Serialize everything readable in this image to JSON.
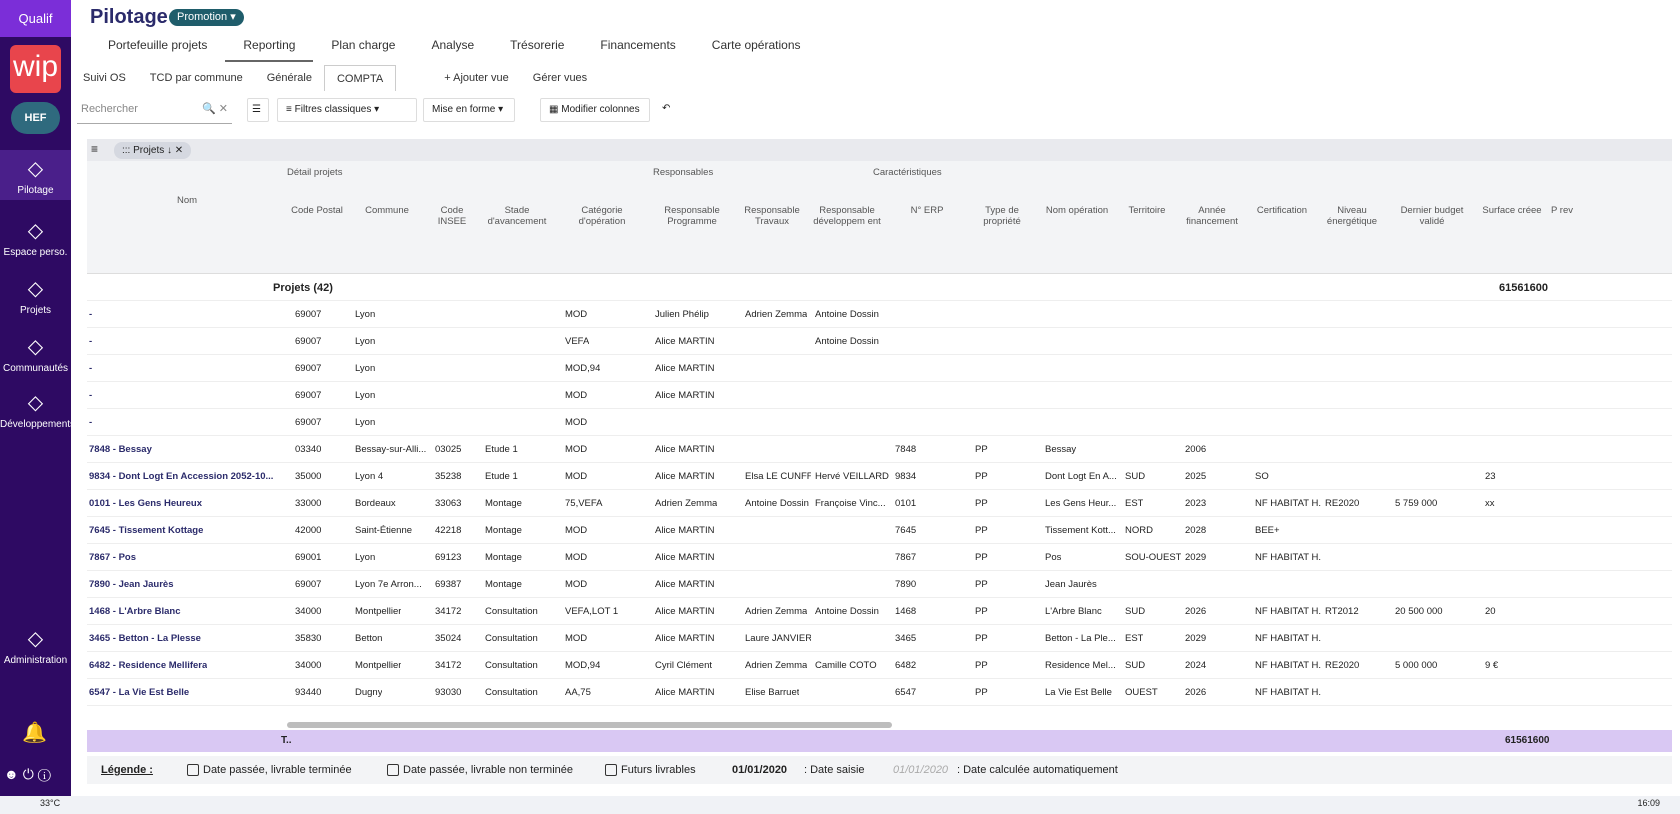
{
  "sidebar": {
    "env": "Qualif",
    "logo": "wip",
    "user": "HEF",
    "items": [
      {
        "label": "Pilotage",
        "icon": "chart-icon"
      },
      {
        "label": "Espace perso.",
        "icon": "home-icon"
      },
      {
        "label": "Projets",
        "icon": "map-icon"
      },
      {
        "label": "Communautés",
        "icon": "users-icon"
      },
      {
        "label": "Développements",
        "icon": "compass-icon"
      },
      {
        "label": "Administration",
        "icon": "gear-icon"
      }
    ]
  },
  "header": {
    "title": "Pilotage",
    "badge": "Promotion ▾"
  },
  "tabs1": [
    "Portefeuille projets",
    "Reporting",
    "Plan charge",
    "Analyse",
    "Trésorerie",
    "Financements",
    "Carte opérations"
  ],
  "tabs2": [
    "Suivi OS",
    "TCD par commune",
    "Générale",
    "COMPTA"
  ],
  "tabs2_actions": [
    "+ Ajouter vue",
    "Gérer vues"
  ],
  "toolbar": {
    "search_placeholder": "Rechercher",
    "filters": "Filtres classiques",
    "format": "Mise en forme",
    "columns": "Modifier colonnes"
  },
  "group_chip": "Projets",
  "header_groups": [
    "Détail projets",
    "Responsables",
    "Caractéristiques"
  ],
  "columns": [
    "Nom",
    "Code Postal",
    "Commune",
    "Code INSEE",
    "Stade d'avancement",
    "Catégorie d'opération",
    "Responsable Programme",
    "Responsable Travaux",
    "Responsable développem ent",
    "N° ERP",
    "Type de propriété",
    "Nom opération",
    "Territoire",
    "Année financement",
    "Certification",
    "Niveau énergétique",
    "Dernier budget validé",
    "Surface créee",
    "P rev"
  ],
  "group_row": {
    "label": "Projets (42)",
    "total": "61561600"
  },
  "rows": [
    [
      "-",
      "69007",
      "Lyon",
      "",
      "",
      "MOD",
      "Julien Phélip",
      "Adrien Zemma",
      "Antoine Dossin",
      "",
      "",
      "",
      "",
      "",
      "",
      "",
      "",
      ""
    ],
    [
      "-",
      "69007",
      "Lyon",
      "",
      "",
      "VEFA",
      "Alice MARTIN",
      "",
      "Antoine Dossin",
      "",
      "",
      "",
      "",
      "",
      "",
      "",
      "",
      ""
    ],
    [
      "-",
      "69007",
      "Lyon",
      "",
      "",
      "MOD,94",
      "Alice MARTIN",
      "",
      "",
      "",
      "",
      "",
      "",
      "",
      "",
      "",
      "",
      ""
    ],
    [
      "-",
      "69007",
      "Lyon",
      "",
      "",
      "MOD",
      "Alice MARTIN",
      "",
      "",
      "",
      "",
      "",
      "",
      "",
      "",
      "",
      "",
      ""
    ],
    [
      "-",
      "69007",
      "Lyon",
      "",
      "",
      "MOD",
      "",
      "",
      "",
      "",
      "",
      "",
      "",
      "",
      "",
      "",
      "",
      ""
    ],
    [
      "7848 - Bessay",
      "03340",
      "Bessay-sur-Alli...",
      "03025",
      "Etude 1",
      "MOD",
      "Alice MARTIN",
      "",
      "",
      "7848",
      "PP",
      "Bessay",
      "",
      "2006",
      "",
      "",
      "",
      ""
    ],
    [
      "9834 - Dont Logt En Accession 2052-10...",
      "35000",
      "Lyon 4",
      "35238",
      "Etude 1",
      "MOD",
      "Alice MARTIN",
      "Elsa LE CUNFF",
      "Hervé VEILLARD",
      "9834",
      "PP",
      "Dont Logt En A...",
      "SUD",
      "2025",
      "SO",
      "",
      "",
      "23"
    ],
    [
      "0101 - Les Gens Heureux",
      "33000",
      "Bordeaux",
      "33063",
      "Montage",
      "75,VEFA",
      "Adrien Zemma",
      "Antoine Dossin",
      "Françoise Vinc...",
      "0101",
      "PP",
      "Les Gens Heur...",
      "EST",
      "2023",
      "NF HABITAT H...",
      "RE2020",
      "5 759 000",
      "xx"
    ],
    [
      "7645 - Tissement Kottage",
      "42000",
      "Saint-Étienne",
      "42218",
      "Montage",
      "MOD",
      "Alice MARTIN",
      "",
      "",
      "7645",
      "PP",
      "Tissement Kott...",
      "NORD",
      "2028",
      "BEE+",
      "",
      "",
      ""
    ],
    [
      "7867 - Pos",
      "69001",
      "Lyon",
      "69123",
      "Montage",
      "MOD",
      "Alice MARTIN",
      "",
      "",
      "7867",
      "PP",
      "Pos",
      "SOU-OUEST",
      "2029",
      "NF HABITAT H...",
      "",
      "",
      ""
    ],
    [
      "7890 - Jean Jaurès",
      "69007",
      "Lyon 7e Arron...",
      "69387",
      "Montage",
      "MOD",
      "Alice MARTIN",
      "",
      "",
      "7890",
      "PP",
      "Jean Jaurès",
      "",
      "",
      "",
      "",
      "",
      ""
    ],
    [
      "1468 - L'Arbre Blanc",
      "34000",
      "Montpellier",
      "34172",
      "Consultation",
      "VEFA,LOT 1",
      "Alice MARTIN",
      "Adrien Zemma",
      "Antoine Dossin",
      "1468",
      "PP",
      "L'Arbre Blanc",
      "SUD",
      "2026",
      "NF HABITAT H...",
      "RT2012",
      "20 500 000",
      "20"
    ],
    [
      "3465 - Betton - La Plesse",
      "35830",
      "Betton",
      "35024",
      "Consultation",
      "MOD",
      "Alice MARTIN",
      "Laure JANVIER",
      "",
      "3465",
      "PP",
      "Betton - La Ple...",
      "EST",
      "2029",
      "NF HABITAT H...",
      "",
      "",
      ""
    ],
    [
      "6482 - Residence Mellifera",
      "34000",
      "Montpellier",
      "34172",
      "Consultation",
      "MOD,94",
      "Cyril Clément",
      "Adrien Zemma",
      "Camille COTO",
      "6482",
      "PP",
      "Residence Mel...",
      "SUD",
      "2024",
      "NF HABITAT H...",
      "RE2020",
      "5 000 000",
      "9 €"
    ],
    [
      "6547 - La Vie Est Belle",
      "93440",
      "Dugny",
      "93030",
      "Consultation",
      "AA,75",
      "Alice MARTIN",
      "Elise Barruet",
      "",
      "6547",
      "PP",
      "La Vie Est Belle",
      "OUEST",
      "2026",
      "NF HABITAT H...",
      "",
      "",
      ""
    ]
  ],
  "total_row": {
    "label": "T..",
    "total": "61561600"
  },
  "legend": {
    "title": "Légende :",
    "items": [
      "Date passée, livrable terminée",
      "Date passée, livrable non terminée",
      "Futurs livrables"
    ],
    "date_saisie_val": "01/01/2020",
    "date_saisie": ": Date saisie",
    "date_calc_val": "01/01/2020",
    "date_calc": ": Date calculée automatiquement"
  },
  "taskbar": {
    "temp": "33°C",
    "time": "16:09"
  }
}
